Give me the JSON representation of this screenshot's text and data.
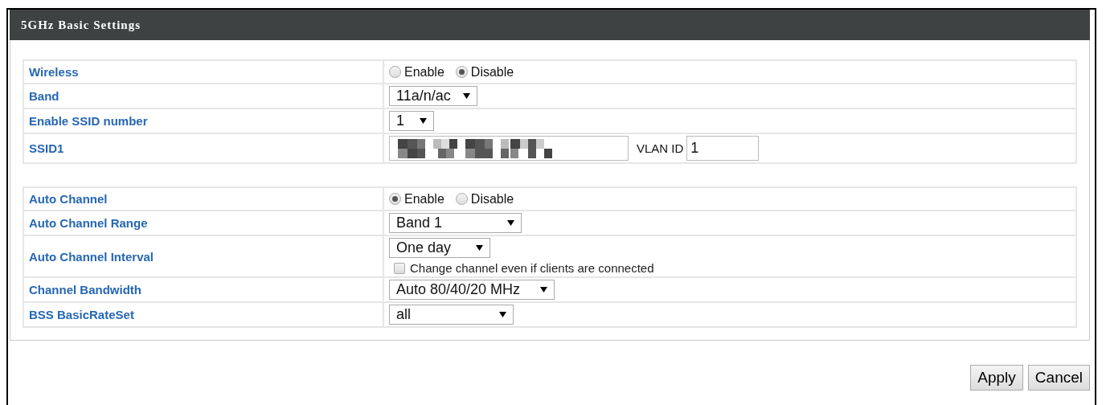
{
  "panel": {
    "title": "5GHz Basic Settings"
  },
  "groups": [
    {
      "rows": [
        {
          "label": "Wireless",
          "kind": "radio",
          "options": [
            {
              "label": "Enable",
              "selected": false
            },
            {
              "label": "Disable",
              "selected": true
            }
          ]
        },
        {
          "label": "Band",
          "kind": "select",
          "value": "11a/n/ac"
        },
        {
          "label": "Enable SSID number",
          "kind": "select",
          "value": "1"
        },
        {
          "label": "SSID1",
          "kind": "ssid",
          "vlan_label": "VLAN ID",
          "vlan_value": "1"
        }
      ]
    },
    {
      "rows": [
        {
          "label": "Auto Channel",
          "kind": "radio",
          "options": [
            {
              "label": "Enable",
              "selected": true
            },
            {
              "label": "Disable",
              "selected": false
            }
          ]
        },
        {
          "label": "Auto Channel Range",
          "kind": "select",
          "value": "Band 1"
        },
        {
          "label": "Auto Channel Interval",
          "kind": "select",
          "value": "One day",
          "checkbox": {
            "label": "Change channel even if clients are connected",
            "checked": false
          }
        },
        {
          "label": "Channel Bandwidth",
          "kind": "select",
          "value": "Auto 80/40/20 MHz"
        },
        {
          "label": "BSS BasicRateSet",
          "kind": "select",
          "value": "all"
        }
      ]
    }
  ],
  "buttons": [
    "Apply",
    "Cancel"
  ]
}
